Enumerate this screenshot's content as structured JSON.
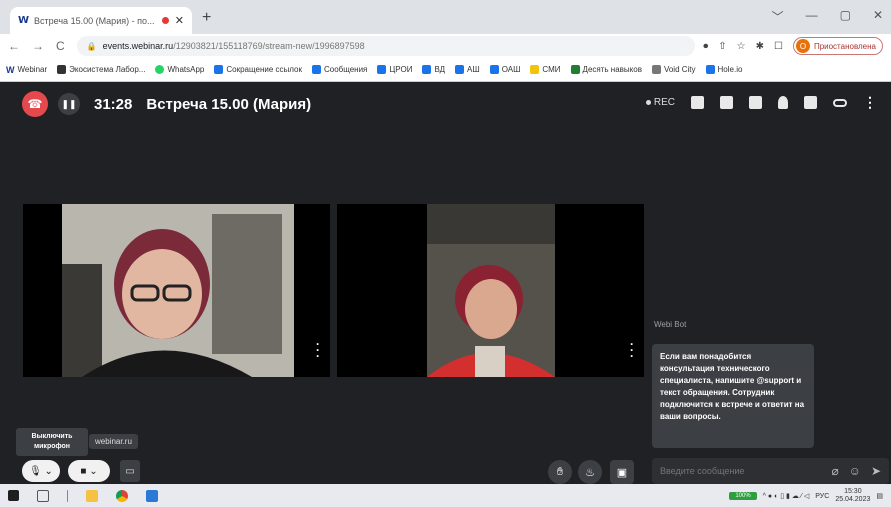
{
  "browser": {
    "tab_title": "Встреча 15.00 (Мария) - по...",
    "tab_close": "✕",
    "new_tab": "+",
    "window_controls": [
      "﹀",
      "—",
      "▢",
      "✕"
    ],
    "nav": [
      "←",
      "→",
      "C"
    ],
    "url_domain": "events.webinar.ru",
    "url_path": "/12903821/155118769/stream-new/1996897598",
    "profile_initial": "О",
    "profile_label": "Приостановлена",
    "toolbar_icons": [
      "⏺",
      "⇧",
      "☆",
      "✱",
      "☐"
    ]
  },
  "bookmarks": [
    {
      "label": "Webinar",
      "icon": "w"
    },
    {
      "label": "Экосистема Лабор...",
      "icon": "dark"
    },
    {
      "label": "WhatsApp",
      "icon": "green"
    },
    {
      "label": "Сокращение ссылок",
      "icon": "blue"
    },
    {
      "label": "Сообщения",
      "icon": "blue"
    },
    {
      "label": "ЦРОИ",
      "icon": "blue"
    },
    {
      "label": "ВД",
      "icon": "blue"
    },
    {
      "label": "АШ",
      "icon": "blue"
    },
    {
      "label": "ОАШ",
      "icon": "blue"
    },
    {
      "label": "СМИ",
      "icon": "yellow"
    },
    {
      "label": "Десять навыков",
      "icon": "darkgreen"
    },
    {
      "label": "Void City",
      "icon": "gray"
    },
    {
      "label": "Hole.io",
      "icon": "blue"
    }
  ],
  "meeting": {
    "timer": "31:28",
    "title": "Встреча 15.00 (Мария)",
    "rec_label": "REC"
  },
  "chat": {
    "author": "Webi Bot",
    "message": "Если вам понадобится консультация технического специалиста, напишите @support и текст обращения. Сотрудник подключится к встрече и ответит на ваши вопросы.",
    "input_placeholder": "Введите сообщение"
  },
  "controls": {
    "mic_tooltip": "Выключить микрофон",
    "site_label": "webinar.ru"
  },
  "taskbar": {
    "battery": "100%",
    "lang": "РУС",
    "time": "15:30",
    "date": "25.04.2023"
  }
}
